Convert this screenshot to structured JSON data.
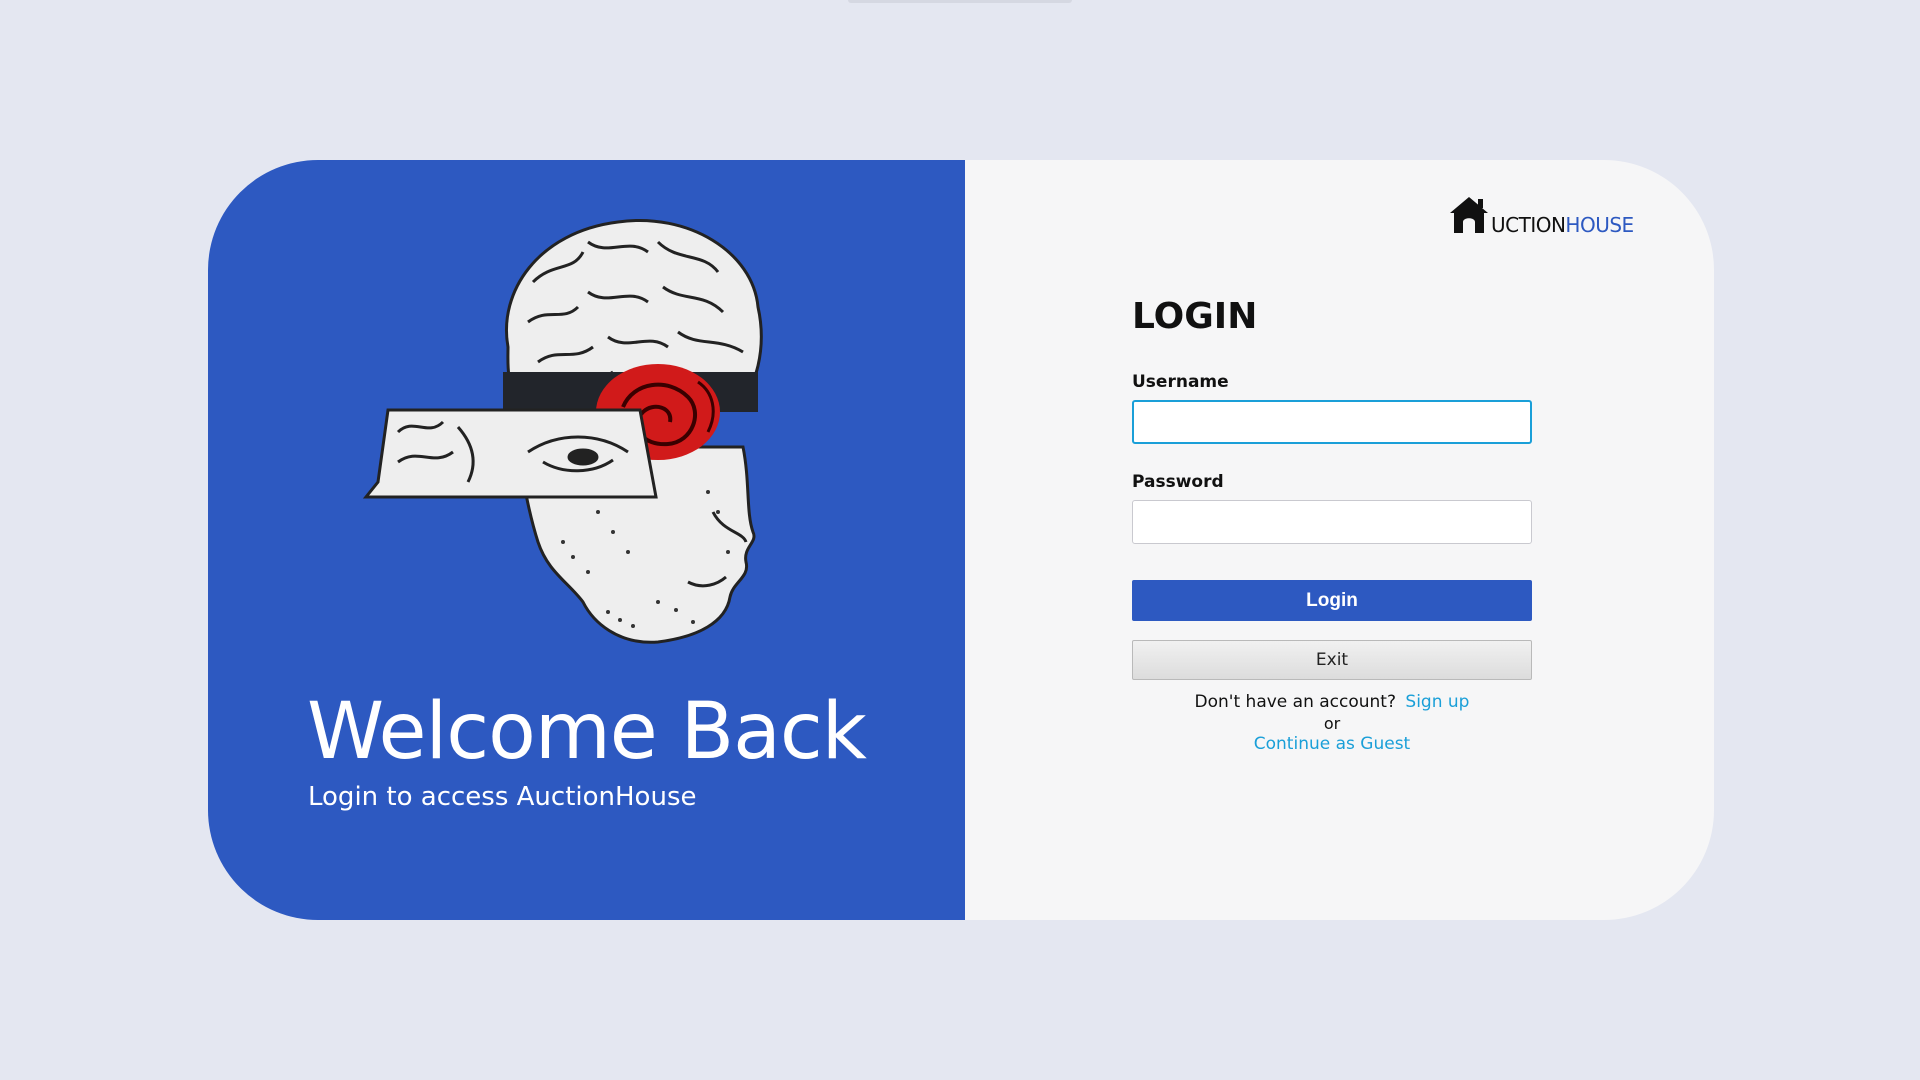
{
  "welcome": {
    "title": "Welcome Back",
    "subtitle": "Login to access AuctionHouse"
  },
  "logo": {
    "part1": "UCTION",
    "part2": "HOUSE",
    "icon": "house-icon"
  },
  "form": {
    "title": "LOGIN",
    "username_label": "Username",
    "username_value": "",
    "password_label": "Password",
    "password_value": "",
    "login_label": "Login",
    "exit_label": "Exit",
    "signup_prompt": "Don't have an account?",
    "signup_link": "Sign up",
    "or_text": "or",
    "guest_link": "Continue as Guest"
  },
  "colors": {
    "brand_blue": "#2d59c1",
    "link_blue": "#1a9fd8",
    "page_bg": "#e4e7f1",
    "panel_bg": "#f6f6f7"
  }
}
